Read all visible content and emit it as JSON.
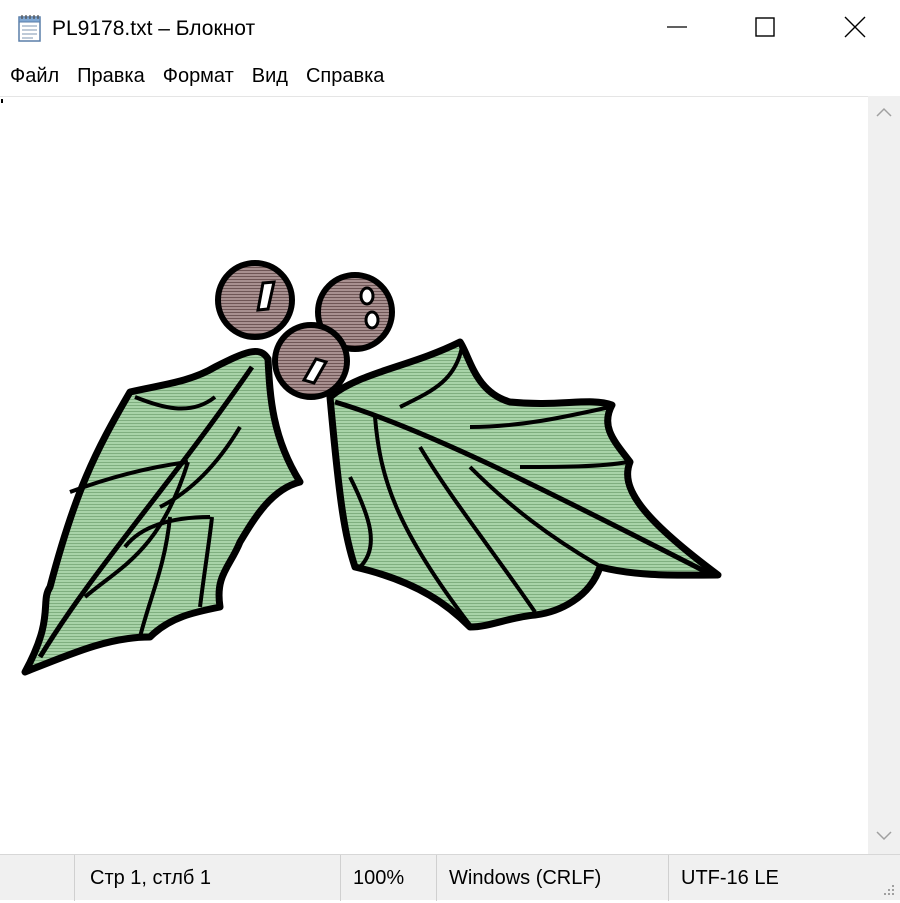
{
  "window": {
    "title": "PL9178.txt – Блокнот",
    "app_icon": "notepad-icon",
    "buttons": {
      "minimize": "minimize-icon",
      "maximize": "maximize-icon",
      "close": "close-icon"
    }
  },
  "menu": {
    "items": [
      {
        "label": "Файл"
      },
      {
        "label": "Правка"
      },
      {
        "label": "Формат"
      },
      {
        "label": "Вид"
      },
      {
        "label": "Справка"
      }
    ]
  },
  "editor": {
    "text": "",
    "image": "holly-leaves-berries-art",
    "colors": {
      "leaf_fill": "#a8d3a8",
      "berry_fill": "#a89090",
      "outline": "#000000"
    }
  },
  "scrollbar": {
    "up": "chevron-up-icon",
    "down": "chevron-down-icon"
  },
  "status": {
    "position": "Стр 1, стлб 1",
    "zoom": "100%",
    "line_ending": "Windows (CRLF)",
    "encoding": "UTF-16 LE"
  }
}
